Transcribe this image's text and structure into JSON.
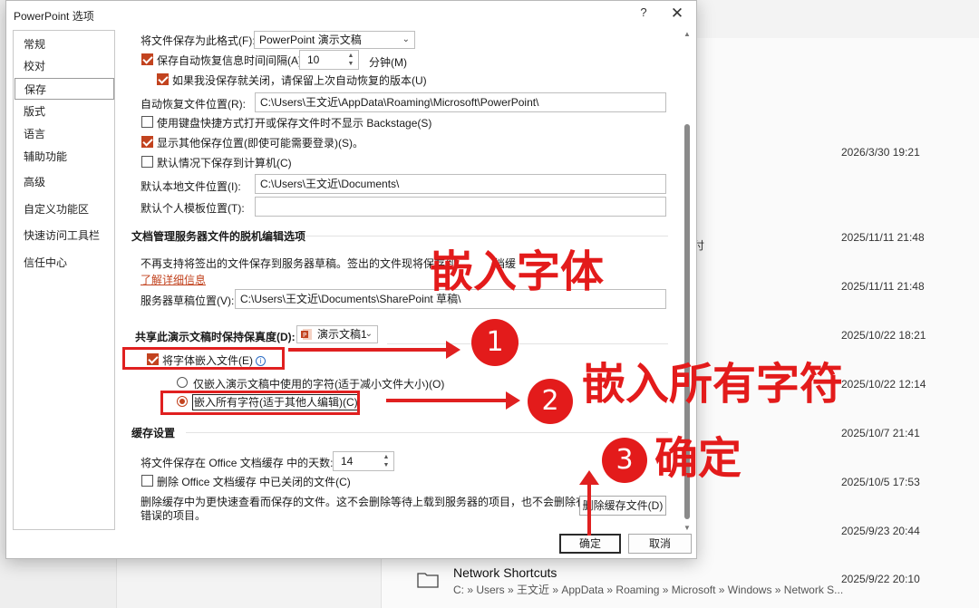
{
  "background": {
    "dates": [
      "2026/3/30 19:21",
      "2025/11/11 21:48",
      "2025/11/11 21:48",
      "2025/10/22 18:21",
      "2025/10/22 12:14",
      "2025/10/7 21:41",
      "2025/10/5 17:53",
      "2025/9/23 20:44"
    ],
    "cut_text": "付",
    "last_file": {
      "name": "Network Shortcuts",
      "path": "C: » Users » 王文近 » AppData » Roaming » Microsoft » Windows » Network S...",
      "date": "2025/9/22 20:10"
    }
  },
  "dialog": {
    "title": "PowerPoint 选项",
    "help": "?",
    "close": "✕",
    "nav": [
      "常规",
      "校对",
      "保存",
      "版式",
      "语言",
      "辅助功能",
      "高级",
      "自定义功能区",
      "快速访问工具栏",
      "信任中心"
    ],
    "save": {
      "format_label": "将文件保存为此格式(F):",
      "format_value": "PowerPoint 演示文稿",
      "autorecover_label": "保存自动恢复信息时间间隔(A)",
      "autorecover_value": "10",
      "minutes_label": "分钟(M)",
      "keep_last_label": "如果我没保存就关闭，请保留上次自动恢复的版本(U)",
      "autorecover_location_label": "自动恢复文件位置(R):",
      "autorecover_location_value": "C:\\Users\\王文近\\AppData\\Roaming\\Microsoft\\PowerPoint\\",
      "no_backstage_label": "使用键盘快捷方式打开或保存文件时不显示 Backstage(S)",
      "show_additional_label": "显示其他保存位置(即使可能需要登录)(S)。",
      "save_to_computer_label": "默认情况下保存到计算机(C)",
      "local_location_label": "默认本地文件位置(I):",
      "local_location_value": "C:\\Users\\王文近\\Documents\\",
      "template_location_label": "默认个人模板位置(T):",
      "template_location_value": ""
    },
    "offline": {
      "heading": "文档管理服务器文件的脱机编辑选项",
      "desc": "不再支持将签出的文件保存到服务器草稿。签出的文件现将保存到",
      "desc_tail": "档缓",
      "learn_more": "了解详细信息",
      "drafts_label": "服务器草稿位置(V):",
      "drafts_value": "C:\\Users\\王文近\\Documents\\SharePoint 草稿\\"
    },
    "fidelity": {
      "heading": "共享此演示文稿时保持保真度(D):",
      "presentation": "演示文稿1",
      "embed_fonts_label": "将字体嵌入文件(E)",
      "info": "i",
      "embed_used_label": "仅嵌入演示文稿中使用的字符(适于减小文件大小)(O)",
      "embed_all_label": "嵌入所有字符(适于其他人编辑)(C)"
    },
    "cache": {
      "heading": "缓存设置",
      "days_label": "将文件保存在 Office 文档缓存 中的天数:",
      "days_value": "14",
      "delete_closed_label": "删除 Office 文档缓存 中已关闭的文件(C)",
      "delete_desc_1": "删除缓存中为更快速查看而保存的文件。这不会删除等待上载到服务器的项目，也不会删除有上载",
      "delete_desc_2": "错误的项目。",
      "delete_button": "删除缓存文件(D)"
    },
    "ok": "确定",
    "cancel": "取消"
  },
  "annotations": {
    "text_embed_fonts": "嵌入字体",
    "text_embed_all": "嵌入所有字符",
    "text_ok": "确定",
    "step1": "1",
    "step2": "2",
    "step3": "3",
    "accent": "#e31b1b"
  }
}
